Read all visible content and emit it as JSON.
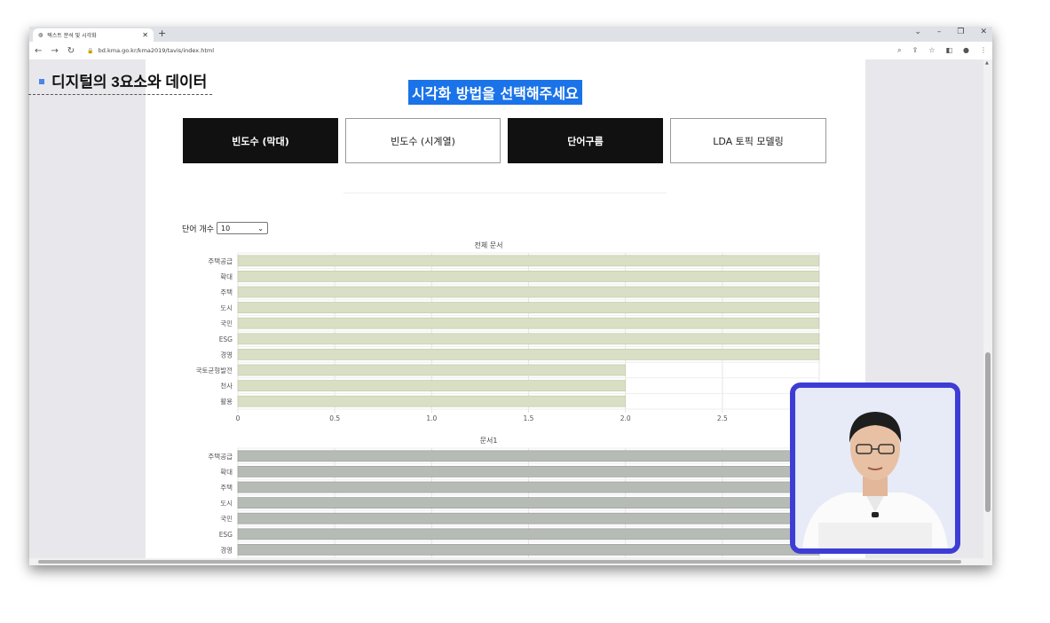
{
  "browser": {
    "tab_title": "텍스트 분석 및 시각화",
    "new_tab": "+",
    "url": "bd.kma.go.kr/kma2019/tavis/index.html"
  },
  "lecture": {
    "title": "디지털의 3요소와 데이터"
  },
  "page": {
    "heading": "시각화 방법을 선택해주세요",
    "buttons": [
      {
        "label": "빈도수 (막대)"
      },
      {
        "label": "빈도수 (시계열)"
      },
      {
        "label": "단어구름"
      },
      {
        "label": "LDA 토픽 모델링"
      }
    ],
    "word_count_label": "단어 개수",
    "word_count_value": "10"
  },
  "colors": {
    "accent": "#1a73e8",
    "dark_button": "#111111",
    "bar_all": "#d9dfc5",
    "bar_doc1": "#b6bbb6",
    "webcam_border": "#3d3dd6"
  },
  "chart_data": [
    {
      "type": "bar",
      "orientation": "horizontal",
      "title": "전체 문서",
      "categories": [
        "주택공급",
        "확대",
        "주택",
        "도시",
        "국민",
        "ESG",
        "경영",
        "국토균형발전",
        "천사",
        "활용"
      ],
      "values": [
        3,
        3,
        3,
        3,
        3,
        3,
        3,
        2,
        2,
        2
      ],
      "xlim": [
        0,
        3
      ],
      "xticks": [
        "0",
        "0.5",
        "1.0",
        "1.5",
        "2.0",
        "2.5"
      ],
      "grid": true
    },
    {
      "type": "bar",
      "orientation": "horizontal",
      "title": "문서1",
      "categories": [
        "주택공급",
        "확대",
        "주택",
        "도시",
        "국민",
        "ESG",
        "경영"
      ],
      "values": [
        3,
        3,
        3,
        3,
        3,
        3,
        3
      ],
      "xlim": [
        0,
        3
      ],
      "grid": true
    }
  ]
}
